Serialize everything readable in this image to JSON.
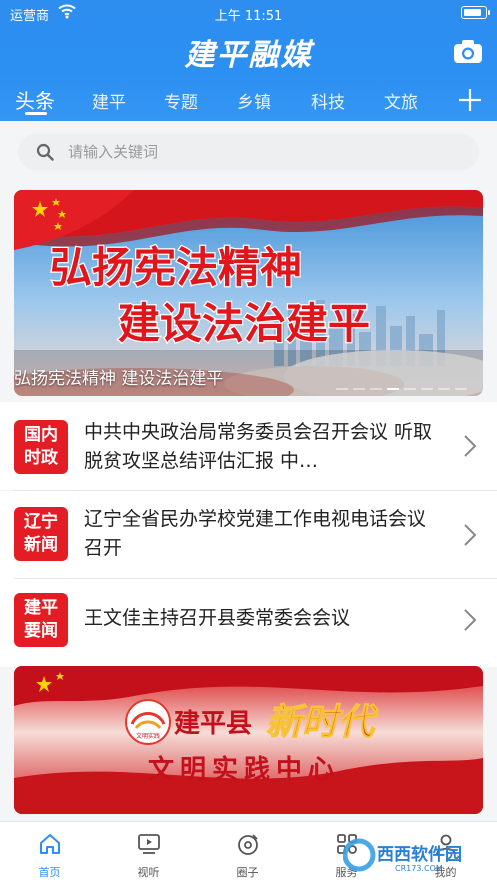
{
  "status_bar": {
    "carrier": "运营商",
    "time": "上午 11:51",
    "battery_level": 0.85
  },
  "header": {
    "app_title": "建平融媒"
  },
  "tabs": [
    {
      "label": "头条",
      "active": true
    },
    {
      "label": "建平"
    },
    {
      "label": "专题"
    },
    {
      "label": "乡镇"
    },
    {
      "label": "科技"
    },
    {
      "label": "文旅"
    }
  ],
  "search": {
    "placeholder": "请输入关键词"
  },
  "banner": {
    "line1": "弘扬宪法精神",
    "line2": "建设法治建平",
    "caption": "弘扬宪法精神 建设法治建平",
    "slides": 8,
    "active_slide": 3
  },
  "news": [
    {
      "badge": [
        "国内",
        "时政"
      ],
      "title": "中共中央政治局常务委员会召开会议 听取脱贫攻坚总结评估汇报 中…"
    },
    {
      "badge": [
        "辽宁",
        "新闻"
      ],
      "title": "辽宁全省民办学校党建工作电视电话会议召开"
    },
    {
      "badge": [
        "建平",
        "要闻"
      ],
      "title": "王文佳主持召开县委常委会会议"
    }
  ],
  "banner2": {
    "county": "建平县",
    "slogan": "新时代",
    "subtitle": "文明实践中心",
    "emblem_text": "文明实践"
  },
  "bottom_nav": [
    {
      "label": "首页",
      "icon": "home-icon",
      "active": true
    },
    {
      "label": "视听",
      "icon": "video-icon"
    },
    {
      "label": "圈子",
      "icon": "circle-icon"
    },
    {
      "label": "服务",
      "icon": "service-icon"
    },
    {
      "label": "我的",
      "icon": "user-icon"
    }
  ],
  "watermark": {
    "brand": "西西软件园",
    "url": "CR173.COM"
  },
  "colors": {
    "primary": "#2c8ff2",
    "badge_red": "#e41c23"
  }
}
